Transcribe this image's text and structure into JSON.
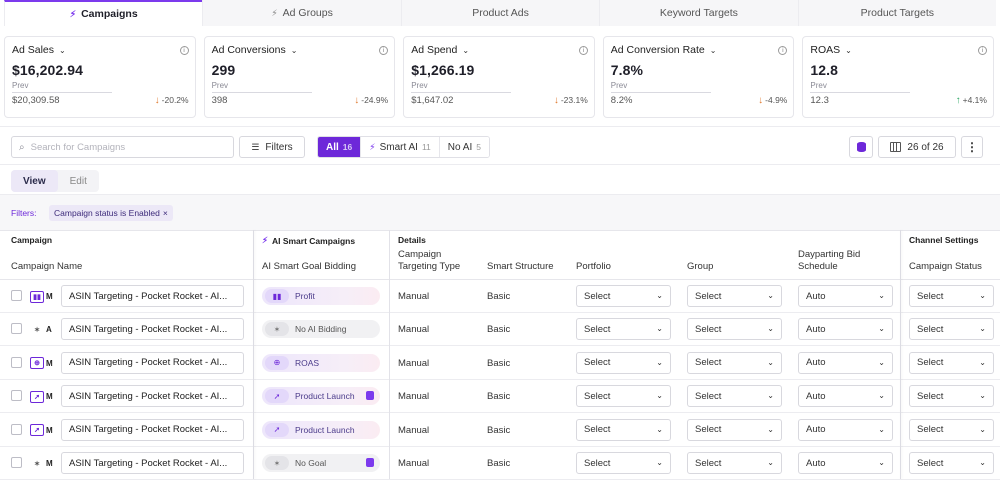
{
  "tabs": [
    {
      "label": "Campaigns",
      "icon": "bolt-icon",
      "active": true
    },
    {
      "label": "Ad Groups",
      "icon": "bolt-icon",
      "active": false
    },
    {
      "label": "Product Ads",
      "icon": "",
      "active": false
    },
    {
      "label": "Keyword Targets",
      "icon": "",
      "active": false
    },
    {
      "label": "Product Targets",
      "icon": "",
      "active": false
    }
  ],
  "metrics": [
    {
      "label": "Ad Sales",
      "value": "$16,202.94",
      "prev_label": "Prev",
      "prev_value": "$20,309.58",
      "change": "-20.2%",
      "direction": "down"
    },
    {
      "label": "Ad Conversions",
      "value": "299",
      "prev_label": "Prev",
      "prev_value": "398",
      "change": "-24.9%",
      "direction": "down"
    },
    {
      "label": "Ad Spend",
      "value": "$1,266.19",
      "prev_label": "Prev",
      "prev_value": "$1,647.02",
      "change": "-23.1%",
      "direction": "down"
    },
    {
      "label": "Ad Conversion Rate",
      "value": "7.8%",
      "prev_label": "Prev",
      "prev_value": "8.2%",
      "change": "-4.9%",
      "direction": "down"
    },
    {
      "label": "ROAS",
      "value": "12.8",
      "prev_label": "Prev",
      "prev_value": "12.3",
      "change": "+4.1%",
      "direction": "up"
    }
  ],
  "toolbar": {
    "search_placeholder": "Search for Campaigns",
    "filters_label": "Filters",
    "segments": [
      {
        "label": "All",
        "count": "16",
        "active": true
      },
      {
        "label": "Smart AI",
        "count": "11",
        "active": false
      },
      {
        "label": "No AI",
        "count": "5",
        "active": false
      }
    ],
    "columns_label": "26 of 26",
    "more_label": "⋮"
  },
  "mode": {
    "view_label": "View",
    "edit_label": "Edit",
    "active": "View"
  },
  "filter_bar": {
    "label": "Filters:",
    "chip": "Campaign status is Enabled",
    "chip_close": "×"
  },
  "table": {
    "groups": {
      "campaign": "Campaign",
      "ai": "AI Smart Campaigns",
      "details": "Details",
      "channel": "Channel Settings"
    },
    "columns": {
      "name": "Campaign Name",
      "goal": "AI Smart Goal Bidding",
      "targeting": "Campaign Targeting Type",
      "structure": "Smart Structure",
      "portfolio": "Portfolio",
      "group": "Group",
      "dayparting": "Dayparting Bid Schedule",
      "status": "Campaign Status"
    },
    "rows": [
      {
        "badge_icon": "bar-chart-icon",
        "badge_glyph": "▮▮",
        "badge": "M",
        "name": "ASIN Targeting - Pocket Rocket - AI...",
        "goal": "Profit",
        "goal_icon": "bar-chart-icon",
        "goal_glyph": "▮▮",
        "goal_style": "pur",
        "goal_tail": false,
        "targeting": "Manual",
        "structure": "Basic",
        "portfolio": "Select",
        "group": "Select",
        "dayparting": "Auto",
        "status": "Select"
      },
      {
        "badge_icon": "no-ai-icon",
        "badge_glyph": "✶",
        "badge": "A",
        "name": "ASIN Targeting - Pocket Rocket - AI...",
        "goal": "No AI Bidding",
        "goal_icon": "no-ai-icon",
        "goal_glyph": "✶",
        "goal_style": "gry",
        "goal_tail": false,
        "targeting": "Manual",
        "structure": "Basic",
        "portfolio": "Select",
        "group": "Select",
        "dayparting": "Auto",
        "status": "Select"
      },
      {
        "badge_icon": "target-icon",
        "badge_glyph": "⊕",
        "badge": "M",
        "name": "ASIN Targeting - Pocket Rocket - AI...",
        "goal": "ROAS",
        "goal_icon": "target-icon",
        "goal_glyph": "⊕",
        "goal_style": "pur",
        "goal_tail": false,
        "targeting": "Manual",
        "structure": "Basic",
        "portfolio": "Select",
        "group": "Select",
        "dayparting": "Auto",
        "status": "Select"
      },
      {
        "badge_icon": "rocket-icon",
        "badge_glyph": "➚",
        "badge": "M",
        "name": "ASIN Targeting - Pocket Rocket - AI...",
        "goal": "Product Launch",
        "goal_icon": "rocket-icon",
        "goal_glyph": "➚",
        "goal_style": "pur",
        "goal_tail": true,
        "targeting": "Manual",
        "structure": "Basic",
        "portfolio": "Select",
        "group": "Select",
        "dayparting": "Auto",
        "status": "Select"
      },
      {
        "badge_icon": "rocket-icon",
        "badge_glyph": "➚",
        "badge": "M",
        "name": "ASIN Targeting - Pocket Rocket - AI...",
        "goal": "Product Launch",
        "goal_icon": "rocket-icon",
        "goal_glyph": "➚",
        "goal_style": "pur",
        "goal_tail": false,
        "targeting": "Manual",
        "structure": "Basic",
        "portfolio": "Select",
        "group": "Select",
        "dayparting": "Auto",
        "status": "Select"
      },
      {
        "badge_icon": "no-ai-icon",
        "badge_glyph": "✶",
        "badge": "M",
        "name": "ASIN Targeting - Pocket Rocket - AI...",
        "goal": "No Goal",
        "goal_icon": "no-ai-icon",
        "goal_glyph": "✶",
        "goal_style": "gry",
        "goal_tail": true,
        "targeting": "Manual",
        "structure": "Basic",
        "portfolio": "Select",
        "group": "Select",
        "dayparting": "Auto",
        "status": "Select"
      }
    ]
  },
  "colors": {
    "accent": "#6d28d9",
    "down": "#e07a2f",
    "up": "#2fa866"
  }
}
